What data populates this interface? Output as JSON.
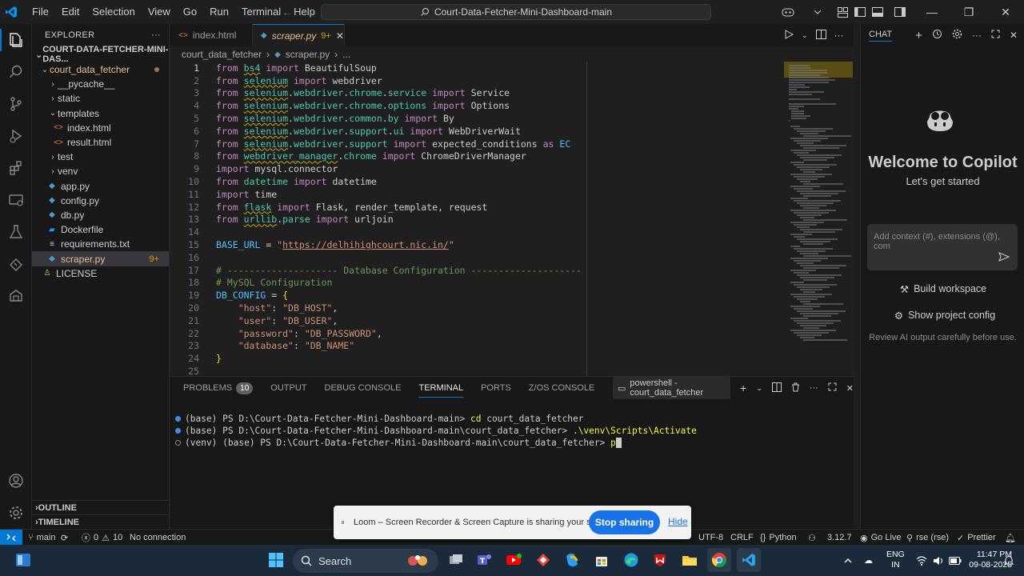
{
  "menu": [
    "File",
    "Edit",
    "Selection",
    "View",
    "Go",
    "Run",
    "Terminal",
    "Help"
  ],
  "command_center": "Court-Data-Fetcher-Mini-Dashboard-main",
  "explorer": {
    "header": "EXPLORER",
    "root": "COURT-DATA-FETCHER-MINI-DAS...",
    "items": [
      {
        "label": "court_data_fetcher"
      },
      {
        "label": "__pycache__"
      },
      {
        "label": "static"
      },
      {
        "label": "templates"
      },
      {
        "label": "index.html"
      },
      {
        "label": "result.html"
      },
      {
        "label": "test"
      },
      {
        "label": "venv"
      },
      {
        "label": "app.py"
      },
      {
        "label": "config.py"
      },
      {
        "label": "db.py"
      },
      {
        "label": "Dockerfile"
      },
      {
        "label": "requirements.txt"
      },
      {
        "label": "scraper.py",
        "badge": "9+"
      },
      {
        "label": "LICENSE"
      }
    ],
    "outline": "OUTLINE",
    "timeline": "TIMELINE"
  },
  "tabs": [
    {
      "label": "index.html"
    },
    {
      "label": "scraper.py",
      "modified": "9+"
    }
  ],
  "breadcrumb": {
    "folder": "court_data_fetcher",
    "file": "scraper.py",
    "more": "..."
  },
  "code_lines": [
    "from bs4 import BeautifulSoup",
    "from selenium import webdriver",
    "from selenium.webdriver.chrome.service import Service",
    "from selenium.webdriver.chrome.options import Options",
    "from selenium.webdriver.common.by import By",
    "from selenium.webdriver.support.ui import WebDriverWait",
    "from selenium.webdriver.support import expected_conditions as EC",
    "from webdriver_manager.chrome import ChromeDriverManager",
    "import mysql.connector",
    "from datetime import datetime",
    "import time",
    "from flask import Flask, render_template, request",
    "from urllib.parse import urljoin",
    "",
    "BASE_URL = \"https://delhihighcourt.nic.in/\"",
    "",
    "# -------------------- Database Configuration --------------------",
    "# MySQL Configuration",
    "DB_CONFIG = {",
    "    \"host\": \"DB_HOST\",",
    "    \"user\": \"DB_USER\",",
    "    \"password\": \"DB_PASSWORD\",",
    "    \"database\": \"DB_NAME\"",
    "}",
    ""
  ],
  "panel": {
    "tabs": [
      "PROBLEMS",
      "OUTPUT",
      "DEBUG CONSOLE",
      "TERMINAL",
      "PORTS",
      "Z/OS CONSOLE"
    ],
    "problems_count": "10",
    "terminal_selector": "powershell - court_data_fetcher",
    "terminal_lines": [
      {
        "prompt": "(base) PS D:\\Court-Data-Fetcher-Mini-Dashboard-main> ",
        "cmd": "cd",
        "arg": " court_data_fetcher"
      },
      {
        "prompt": "(base) PS D:\\Court-Data-Fetcher-Mini-Dashboard-main\\court_data_fetcher> ",
        "cmd": ".\\venv\\Scripts\\Activate",
        "arg": ""
      },
      {
        "prompt": "(venv) (base) PS D:\\Court-Data-Fetcher-Mini-Dashboard-main\\court_data_fetcher> ",
        "cmd": "p",
        "arg": ""
      }
    ]
  },
  "chat": {
    "title": "CHAT",
    "welcome": "Welcome to Copilot",
    "subtitle": "Let's get started",
    "input_placeholder": "Add context (#), extensions (@), com",
    "build_workspace": "Build workspace",
    "show_project_config": "Show project config",
    "review": "Review AI output carefully before use."
  },
  "statusbar": {
    "branch": "main",
    "errors": "0",
    "warnings": "10",
    "connection": "No connection",
    "encoding": "UTF-8",
    "eol": "CRLF",
    "language": "Python",
    "python_version": "3.12.7",
    "go_live": "Go Live",
    "rse": "rse (rse)",
    "prettier": "Prettier"
  },
  "loom": {
    "message": "Loom – Screen Recorder & Screen Capture is sharing your screen.",
    "stop": "Stop sharing",
    "hide": "Hide"
  },
  "taskbar": {
    "search": "Search",
    "lang1": "ENG",
    "lang2": "IN",
    "time": "11:47 PM",
    "date": "09-08-2025"
  },
  "colors": {
    "accent": "#0078d4",
    "keyword": "#c586c0",
    "module": "#4ec9b0",
    "string": "#ce9178",
    "comment": "#6a9955",
    "warning": "#cca700"
  }
}
